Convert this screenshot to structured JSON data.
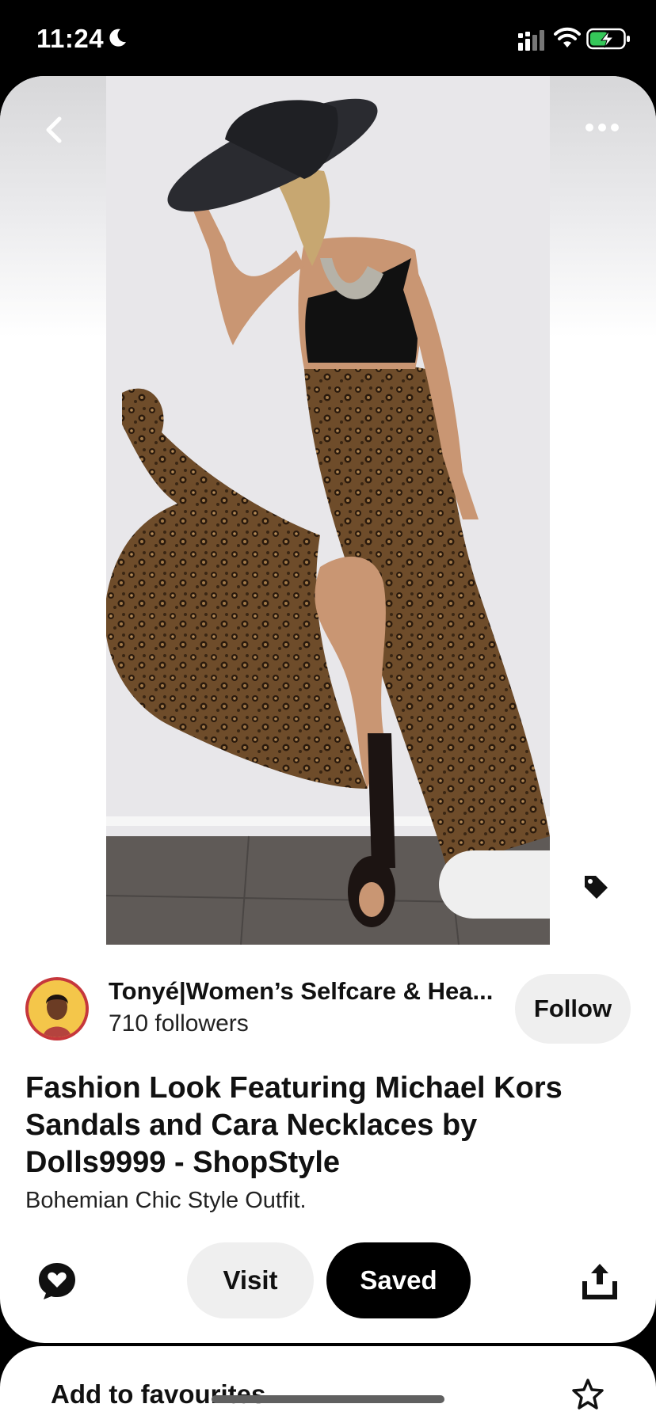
{
  "status_bar": {
    "time": "11:24",
    "moon_icon": "moon-icon",
    "signal_icon": "cellular-signal-icon",
    "wifi_icon": "wifi-icon",
    "battery_icon": "battery-charging-icon",
    "battery_color": "#35c759"
  },
  "pin": {
    "image_icon": "pin-photo",
    "back_icon": "chevron-left-icon",
    "more_icon": "more-dots-icon",
    "tag_icon": "tag-icon"
  },
  "creator": {
    "name": "Tonyé|Women’s Selfcare & Hea...",
    "followers": "710 followers",
    "follow_label": "Follow"
  },
  "title": "Fashion Look Featuring Michael Kors Sandals and Cara Necklaces by Dolls9999 - ShopStyle",
  "description": "Bohemian Chic Style Outfit.",
  "actions": {
    "comment_icon": "comment-heart-icon",
    "visit_label": "Visit",
    "saved_label": "Saved",
    "share_icon": "share-icon"
  },
  "bottom_sheet": {
    "label": "Add to favourites",
    "star_icon": "star-icon"
  },
  "colors": {
    "primary_button": "#000000",
    "secondary_button": "#efefef",
    "avatar_ring": "#c6373c"
  }
}
